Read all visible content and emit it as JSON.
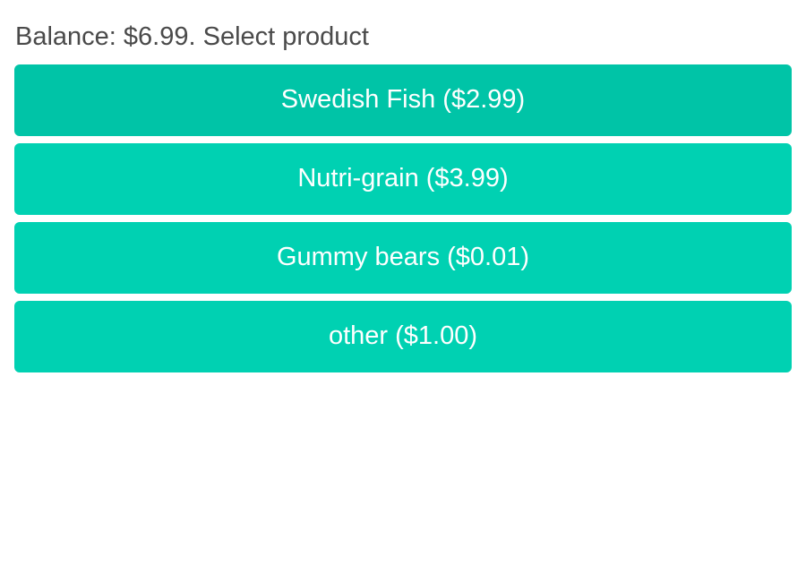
{
  "header": {
    "text": "Balance: $6.99. Select product"
  },
  "products": [
    {
      "label": "Swedish Fish ($2.99)",
      "state": "hovered"
    },
    {
      "label": "Nutri-grain ($3.99)",
      "state": "normal"
    },
    {
      "label": "Gummy bears ($0.01)",
      "state": "normal"
    },
    {
      "label": "other ($1.00)",
      "state": "normal"
    }
  ],
  "colors": {
    "button": "#00d1b2",
    "button_hover": "#00c4a7",
    "button_text": "#ffffff",
    "heading_text": "#4a4a4a",
    "background": "#ffffff"
  }
}
